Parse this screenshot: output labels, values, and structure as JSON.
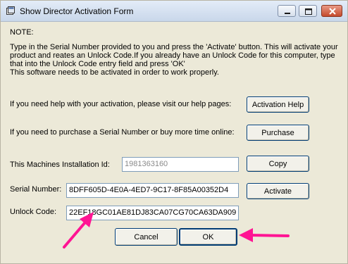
{
  "window": {
    "title": "Show Director Activation Form",
    "controls": [
      "minimize-icon",
      "maximize-icon",
      "close-icon"
    ]
  },
  "note": {
    "heading": "NOTE:",
    "lines": [
      "Type in the Serial Number provided to you and press the 'Activate' button. This will activate your",
      "product and reates an Unlock Code.If you already have an Unlock Code for this computer, type",
      "that into the Unlock Code entry field and press 'OK'",
      "This software needs to be activated in order to work properly."
    ]
  },
  "help": {
    "text": "If you need help with your activation, please visit our help pages:",
    "button": "Activation Help"
  },
  "purchase": {
    "text": "If you need to purchase a Serial Number or buy more time online:",
    "button": "Purchase"
  },
  "installation": {
    "label": "This Machines Installation Id:",
    "value": "1981363160",
    "copy_button": "Copy"
  },
  "serial": {
    "label": "Serial Number:",
    "value": "8DFF605D-4E0A-4ED7-9C17-8F85A00352D4",
    "activate_button": "Activate"
  },
  "unlock": {
    "label": "Unlock Code:",
    "value": "22EF18GC01AE81DJ83CA07CG70CA63DA909"
  },
  "footer": {
    "cancel": "Cancel",
    "ok": "OK"
  },
  "colors": {
    "annotation_arrow": "#ff1493",
    "dialog_face": "#ece9d8"
  }
}
